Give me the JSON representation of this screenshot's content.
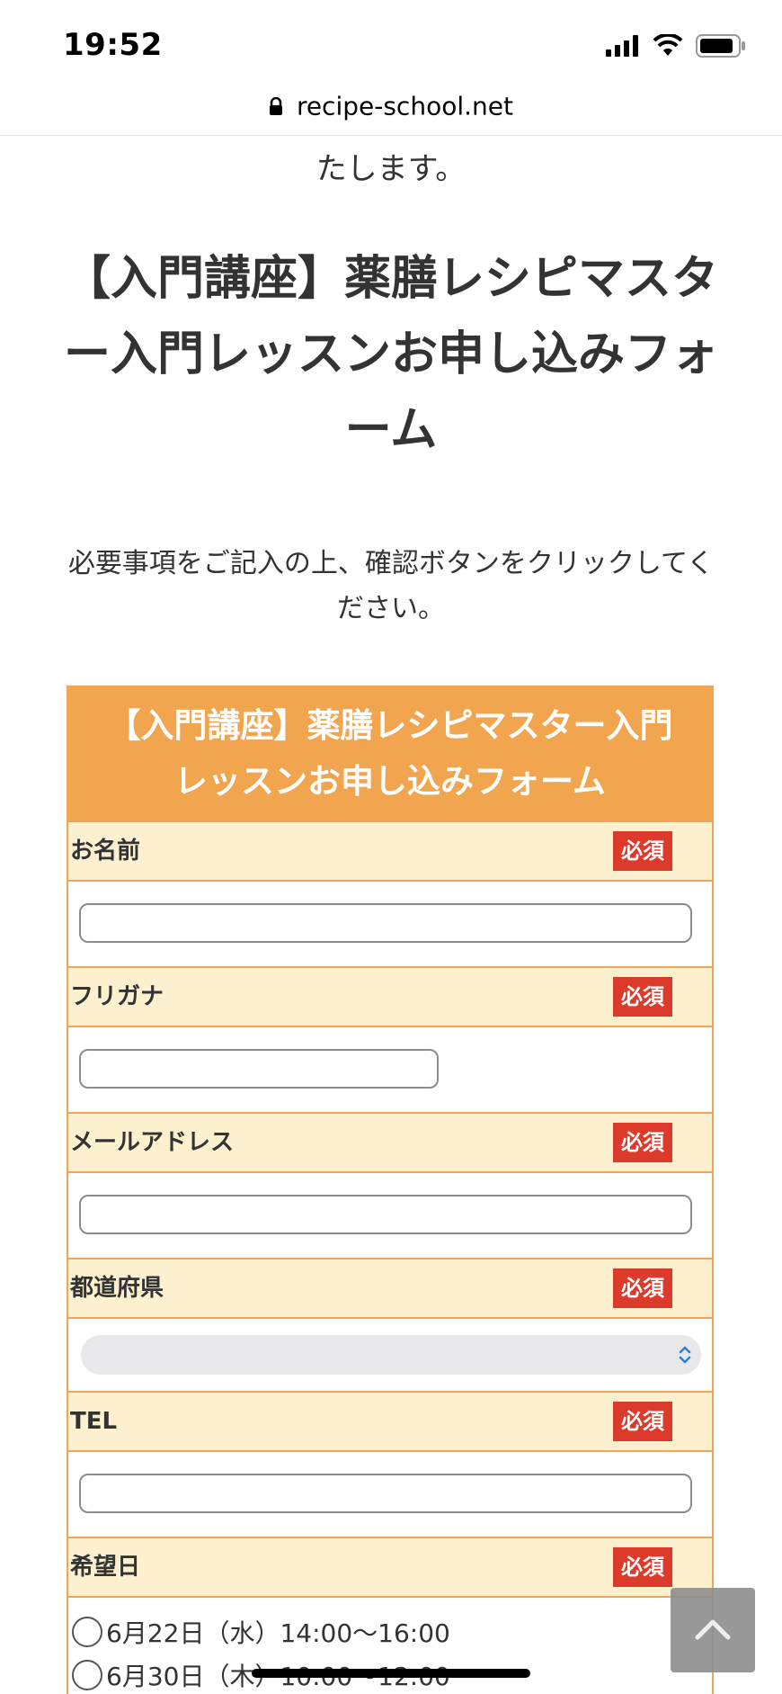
{
  "status_bar": {
    "time": "19:52"
  },
  "browser": {
    "url": "recipe-school.net"
  },
  "intro_tail": "たします。",
  "page_title": "【入門講座】薬膳レシピマスター入門レッスンお申し込みフォーム",
  "instructions": "必要事項をご記入の上、確認ボタンをクリックしてください。",
  "form": {
    "header_line1": "【入門講座】薬膳レシピマスター入門",
    "header_line2": "レッスンお申し込みフォーム",
    "required_label": "必須",
    "fields": [
      {
        "label": "お名前",
        "type": "text",
        "value": ""
      },
      {
        "label": "フリガナ",
        "type": "text",
        "value": ""
      },
      {
        "label": "メールアドレス",
        "type": "text",
        "value": ""
      },
      {
        "label": "都道府県",
        "type": "select",
        "value": ""
      },
      {
        "label": "TEL",
        "type": "text",
        "value": ""
      },
      {
        "label": "希望日",
        "type": "radio"
      }
    ],
    "date_options": [
      "6月22日（水）14:00〜16:00",
      "6月30日（木）10:00〜12:00"
    ]
  },
  "icons": {
    "lock": "lock-icon",
    "signal": "cellular-signal-icon",
    "wifi": "wifi-icon",
    "battery": "battery-icon",
    "select_arrow": "chevron-up-down-icon",
    "scroll_top": "chevron-up-icon"
  },
  "colors": {
    "form_header": "#f0a54e",
    "form_border": "#f0a55a",
    "label_bg": "#fdf0cf",
    "required_badge": "#dc3b2c"
  }
}
